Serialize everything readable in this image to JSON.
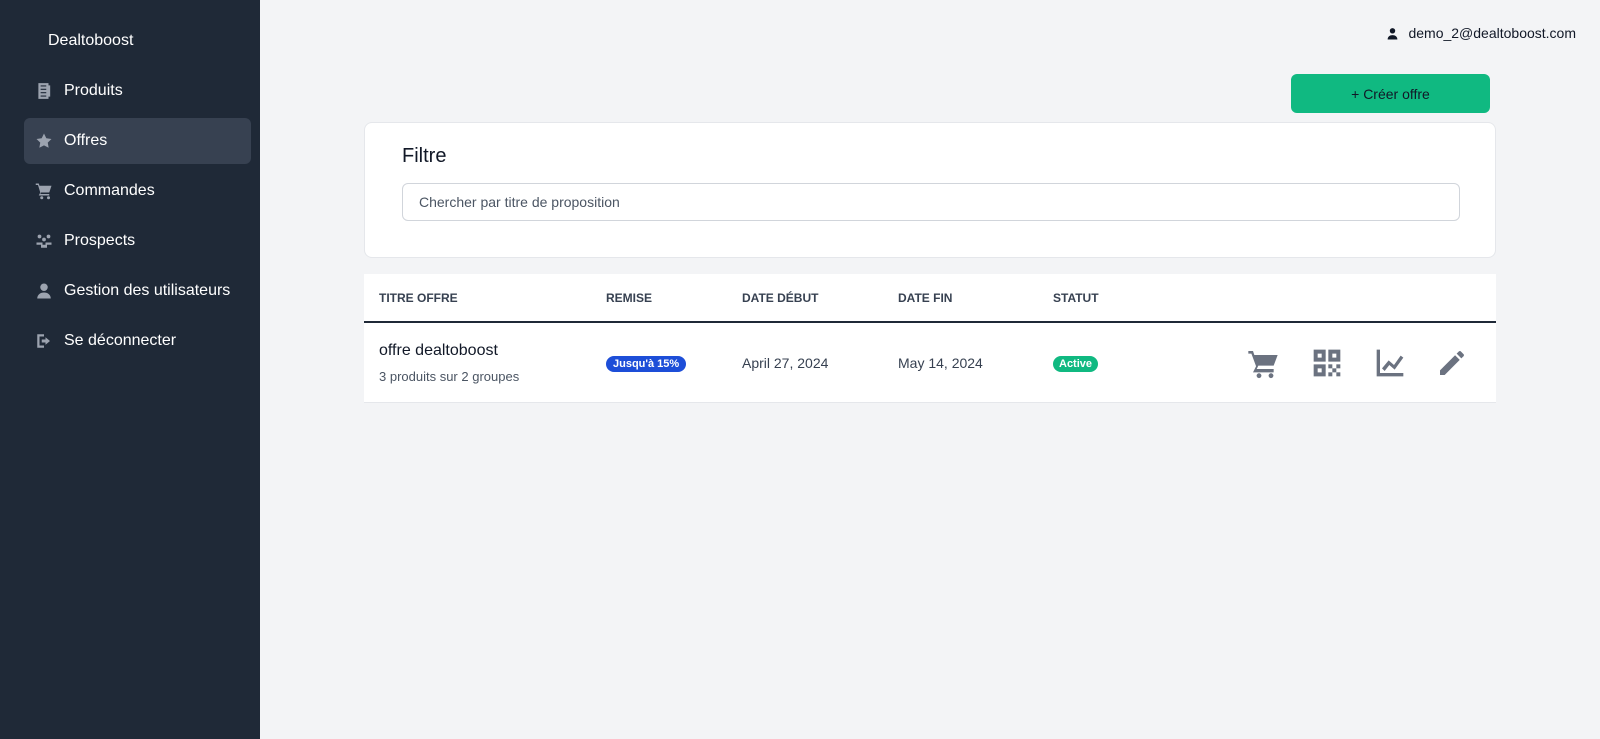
{
  "sidebar": {
    "brand": "Dealtoboost",
    "items": [
      {
        "label": "Produits",
        "icon": "product-icon"
      },
      {
        "label": "Offres",
        "icon": "star-icon"
      },
      {
        "label": "Commandes",
        "icon": "cart-icon"
      },
      {
        "label": "Prospects",
        "icon": "people-icon"
      },
      {
        "label": "Gestion des utilisateurs",
        "icon": "user-icon"
      },
      {
        "label": "Se déconnecter",
        "icon": "logout-icon"
      }
    ],
    "active_item": "Offres"
  },
  "header": {
    "user_email": "demo_2@dealtoboost.com"
  },
  "toolbar": {
    "create_label": "+ Créer offre"
  },
  "filter": {
    "title": "Filtre",
    "search_placeholder": "Chercher par titre de proposition",
    "search_value": ""
  },
  "table": {
    "columns": [
      "TITRE OFFRE",
      "REMISE",
      "DATE DÉBUT",
      "DATE FIN",
      "STATUT"
    ],
    "rows": [
      {
        "title": "offre dealtoboost",
        "subtitle": "3 produits sur 2 groupes",
        "discount": "Jusqu'à 15%",
        "start_date": "April 27, 2024",
        "end_date": "May 14, 2024",
        "status": "Active",
        "actions": [
          "cart-icon",
          "qr-code-icon",
          "chart-line-icon",
          "pencil-icon"
        ]
      }
    ]
  },
  "colors": {
    "sidebar_bg": "#1f2937",
    "active_nav_bg": "#374151",
    "accent_green": "#10b981",
    "badge_blue": "#1d4ed8",
    "page_bg": "#f3f4f6"
  }
}
